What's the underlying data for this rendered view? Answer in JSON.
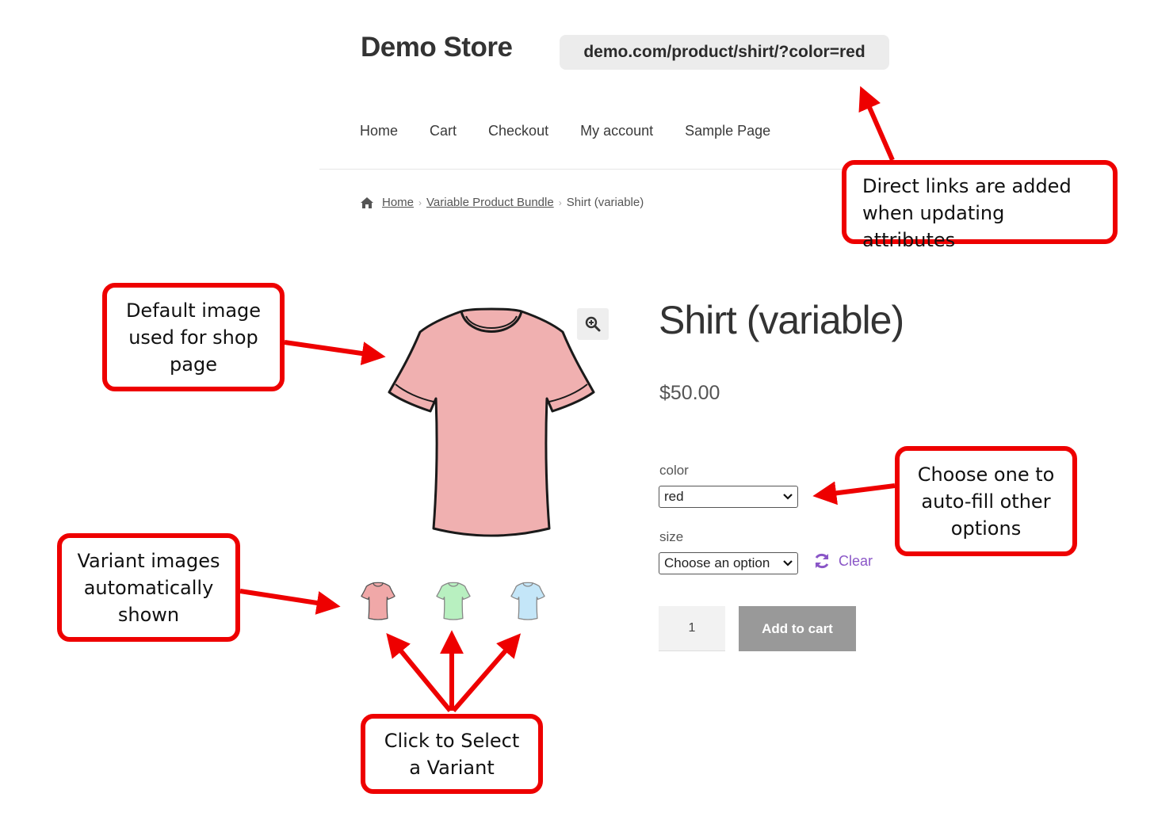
{
  "header": {
    "site_title": "Demo Store",
    "url": "demo.com/product/shirt/?color=red"
  },
  "nav": {
    "items": [
      "Home",
      "Cart",
      "Checkout",
      "My account",
      "Sample Page"
    ]
  },
  "breadcrumb": {
    "items": [
      "Home",
      "Variable Product Bundle",
      "Shirt (variable)"
    ],
    "separator": "›"
  },
  "gallery": {
    "main_color": "#f0b0b0",
    "thumbnails": [
      {
        "color": "#f0a8a8",
        "name": "red"
      },
      {
        "color": "#b8f0c0",
        "name": "green"
      },
      {
        "color": "#c4e6f8",
        "name": "blue"
      }
    ],
    "zoom_icon": "zoom-in-icon"
  },
  "product": {
    "title": "Shirt (variable)",
    "price": "$50.00",
    "color_label": "color",
    "color_value": "red",
    "size_label": "size",
    "size_value": "Choose an option",
    "clear_label": "Clear",
    "quantity": "1",
    "add_to_cart": "Add to cart"
  },
  "annotations": {
    "accent_color": "#ee0000",
    "direct_links": [
      "Direct links are added",
      "when updating attributes"
    ],
    "default_image": [
      "Default image",
      "used for shop",
      "page"
    ],
    "choose_one": [
      "Choose one to",
      "auto-fill other",
      "options"
    ],
    "variant_images": [
      "Variant images",
      "automatically",
      "shown"
    ],
    "click_select": [
      "Click to Select",
      "a Variant"
    ]
  }
}
